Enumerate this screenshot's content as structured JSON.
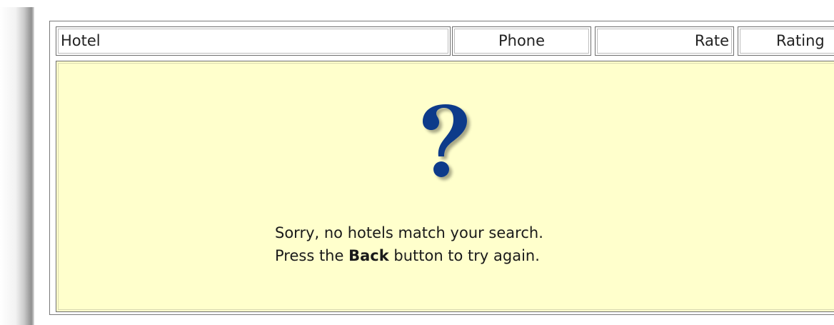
{
  "table": {
    "columns": {
      "hotel": "Hotel",
      "phone": "Phone",
      "rate": "Rate",
      "rating": "Rating"
    }
  },
  "empty_state": {
    "icon": "question-mark-icon",
    "icon_color": "#0d3a8a",
    "panel_color": "#ffffcc",
    "line1": "Sorry, no hotels match your search.",
    "line2_prefix": "Press the ",
    "line2_bold": "Back",
    "line2_suffix": " button to try again."
  }
}
